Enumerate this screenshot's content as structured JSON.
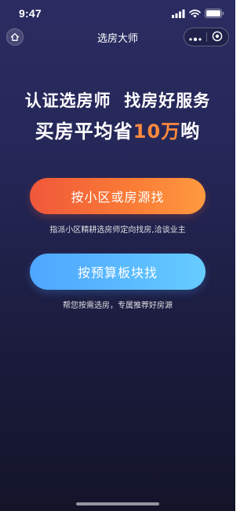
{
  "status_bar": {
    "time": "9:47",
    "icons": [
      "cellular-signal-icon",
      "wifi-icon",
      "battery-icon"
    ]
  },
  "nav": {
    "title": "选房大师",
    "home_icon": "home-icon",
    "more_icon": "more-dots-icon",
    "close_icon": "target-close-icon"
  },
  "hero": {
    "line1": "认证选房师  找房好服务",
    "line2_prefix": "买房平均省",
    "line2_highlight": "10万",
    "line2_suffix": "哟"
  },
  "actions": [
    {
      "label": "按小区或房源找",
      "caption": "指派小区精耕选房师定向找房,洽谈业主"
    },
    {
      "label": "按预算板块找",
      "caption": "帮您按需选房，专属推荐好房源"
    }
  ],
  "colors": {
    "background_top": "#2b2d62",
    "background_bottom": "#131429",
    "highlight": "#ff8a3c",
    "primary_button_start": "#f0573a",
    "primary_button_end": "#ff9a40",
    "secondary_button_start": "#4fa6ff",
    "secondary_button_end": "#66ccff"
  }
}
